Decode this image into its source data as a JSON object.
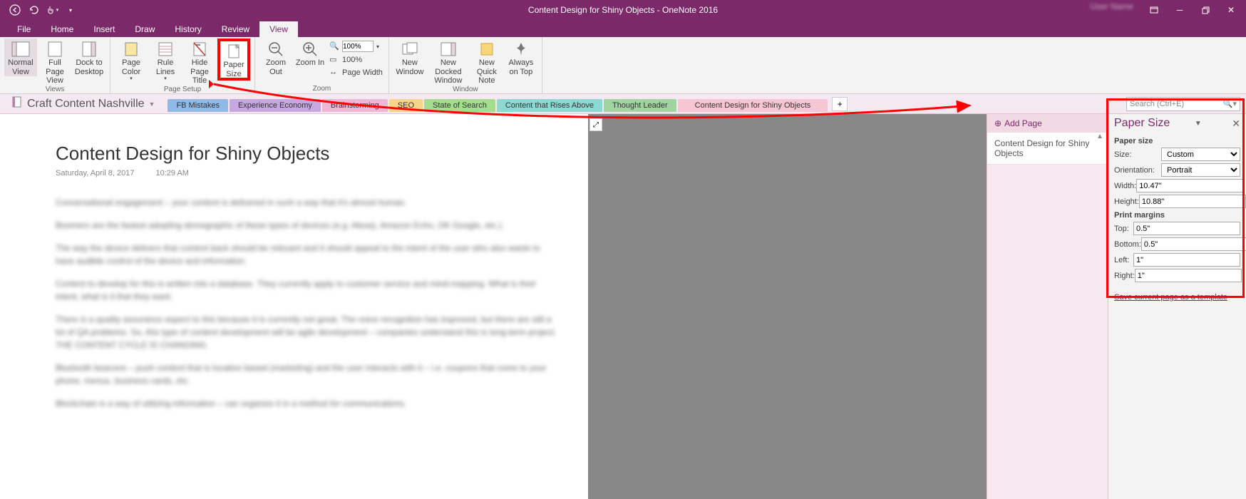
{
  "app": {
    "title": "Content Design for Shiny Objects  -  OneNote 2016",
    "user": "User Name"
  },
  "tabs": {
    "file": "File",
    "home": "Home",
    "insert": "Insert",
    "draw": "Draw",
    "history": "History",
    "review": "Review",
    "view": "View"
  },
  "ribbon": {
    "views_group": "Views",
    "normal_view": "Normal View",
    "full_page_view": "Full Page View",
    "dock_to_desktop": "Dock to Desktop",
    "page_setup_group": "Page Setup",
    "page_color": "Page Color",
    "rule_lines": "Rule Lines",
    "hide_page_title": "Hide Page Title",
    "paper_size": "Paper Size",
    "zoom_group": "Zoom",
    "zoom_out": "Zoom Out",
    "zoom_in": "Zoom In",
    "zoom_100a": "100%",
    "zoom_100b": "100%",
    "page_width": "Page Width",
    "window_group": "Window",
    "new_window": "New Window",
    "new_docked_window": "New Docked Window",
    "new_quick_note": "New Quick Note",
    "always_on_top": "Always on Top"
  },
  "notebook": {
    "name": "Craft Content Nashville",
    "search_placeholder": "Search (Ctrl+E)"
  },
  "sections": [
    {
      "label": "FB Mistakes",
      "color": "#8fb9e6"
    },
    {
      "label": "Experience Economy",
      "color": "#c7a7e0"
    },
    {
      "label": "Brainstorming",
      "color": "#f0b6d6"
    },
    {
      "label": "SEO",
      "color": "#f6d58a"
    },
    {
      "label": "State of Search",
      "color": "#a5dd8e"
    },
    {
      "label": "Content that Rises Above",
      "color": "#8bd9d0"
    },
    {
      "label": "Thought Leader",
      "color": "#a2d4a2"
    },
    {
      "label": "Content Design for Shiny Objects",
      "color": "#f7c6d4"
    }
  ],
  "page": {
    "title": "Content Design for Shiny Objects",
    "date": "Saturday, April 8, 2017",
    "time": "10:29 AM"
  },
  "page_list": {
    "add": "Add Page",
    "items": [
      "Content Design for Shiny Objects"
    ]
  },
  "paper_panel": {
    "title": "Paper Size",
    "section1": "Paper size",
    "size_label": "Size:",
    "size_value": "Custom",
    "orient_label": "Orientation:",
    "orient_value": "Portrait",
    "width_label": "Width:",
    "width_value": "10.47\"",
    "height_label": "Height:",
    "height_value": "10.88\"",
    "section2": "Print margins",
    "top_label": "Top:",
    "top_value": "0.5\"",
    "bottom_label": "Bottom:",
    "bottom_value": "0.5\"",
    "left_label": "Left:",
    "left_value": "1\"",
    "right_label": "Right:",
    "right_value": "1\"",
    "save_link": "Save current page as a template"
  }
}
